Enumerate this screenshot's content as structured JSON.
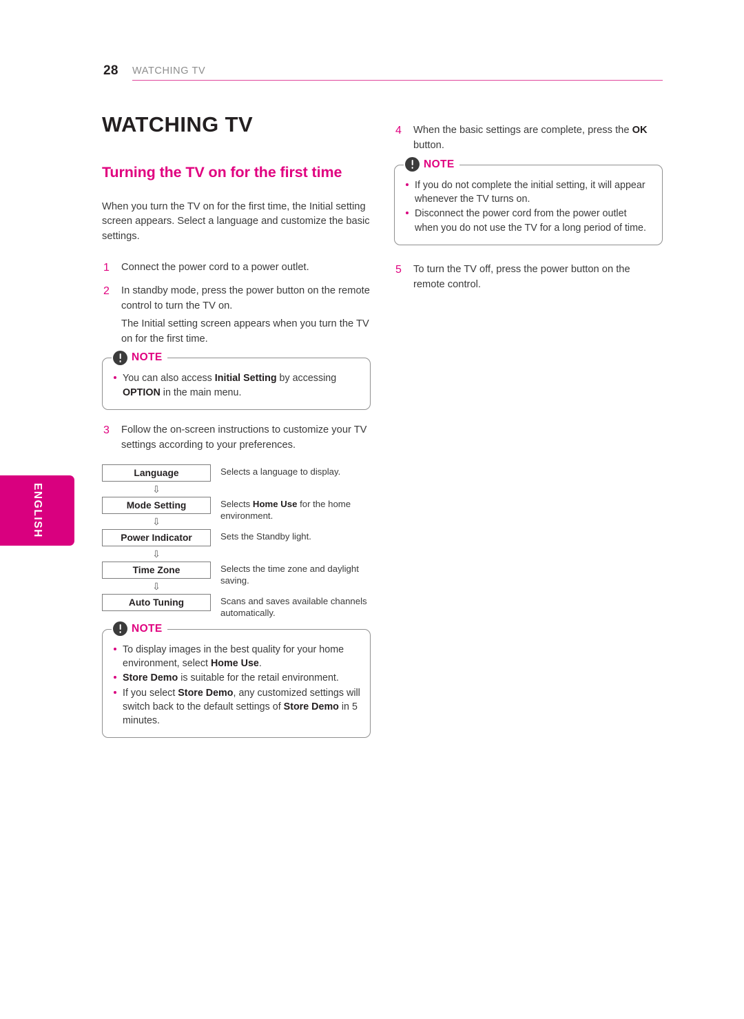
{
  "header": {
    "page_number": "28",
    "chapter": "WATCHING TV",
    "rule_color": "#e0459b"
  },
  "language_tab": {
    "label": "ENGLISH",
    "background": "#d9007f",
    "text_color": "#ffffff"
  },
  "chapter_title": "WATCHING TV",
  "section_title": "Turning the TV on for the first time",
  "intro_paragraph": "When you turn the TV on for the first time, the Initial setting screen appears. Select a language and customize the basic settings.",
  "steps": {
    "step1": {
      "num": "1",
      "line1": "Connect the power cord to a power outlet."
    },
    "step2": {
      "num": "2",
      "line1": "In standby mode, press the power button on the remote control to turn the TV on.",
      "line2": "The Initial setting screen appears when you turn the TV on for the first time."
    },
    "step3": {
      "num": "3",
      "line1": "Follow the on-screen instructions to customize your TV settings according to your preferences."
    },
    "step4": {
      "num": "4",
      "line1_pre": "When the basic settings are complete, press the ",
      "line1_bold": "OK",
      "line1_post": " button."
    },
    "step5": {
      "num": "5",
      "line1": "To turn the TV off, press the power button on the remote control."
    }
  },
  "note_label": "NOTE",
  "note_icon_name": "exclamation-circle-icon",
  "note_color": "#e0007f",
  "note_left_1": {
    "items": [
      {
        "pre": "You can also access ",
        "bold1": "Initial Setting",
        "mid": " by accessing ",
        "bold2": "OPTION",
        "post": " in the main menu."
      }
    ]
  },
  "note_right_1": {
    "items": [
      {
        "text": "If you do not complete the initial setting, it will appear whenever the TV turns on."
      },
      {
        "text": "Disconnect the power cord from the power outlet when you do not use the TV for a long period of time."
      }
    ]
  },
  "note_left_2": {
    "items": [
      {
        "pre": "To display images in the best quality for your home environment, select ",
        "bold1": "Home Use",
        "post": "."
      },
      {
        "bold_first": "Store Demo",
        "post": " is suitable for the retail environment."
      },
      {
        "pre": "If you select ",
        "bold1": "Store Demo",
        "mid": ", any customized settings will switch back to the default settings of ",
        "bold2": "Store Demo",
        "post": " in 5 minutes."
      }
    ]
  },
  "flow": {
    "arrow_glyph": "⇩",
    "rows": [
      {
        "box": "Language",
        "desc_pre": "Selects a language to display.",
        "desc_bold": "",
        "desc_post": ""
      },
      {
        "box": "Mode Setting",
        "desc_pre": "Selects ",
        "desc_bold": "Home Use",
        "desc_post": " for the home environment."
      },
      {
        "box": "Power Indicator",
        "desc_pre": "Sets the Standby light.",
        "desc_bold": "",
        "desc_post": ""
      },
      {
        "box": "Time Zone",
        "desc_pre": "Selects the time zone and daylight saving.",
        "desc_bold": "",
        "desc_post": ""
      },
      {
        "box": "Auto Tuning",
        "desc_pre": "Scans and saves available channels automatically.",
        "desc_bold": "",
        "desc_post": ""
      }
    ]
  }
}
